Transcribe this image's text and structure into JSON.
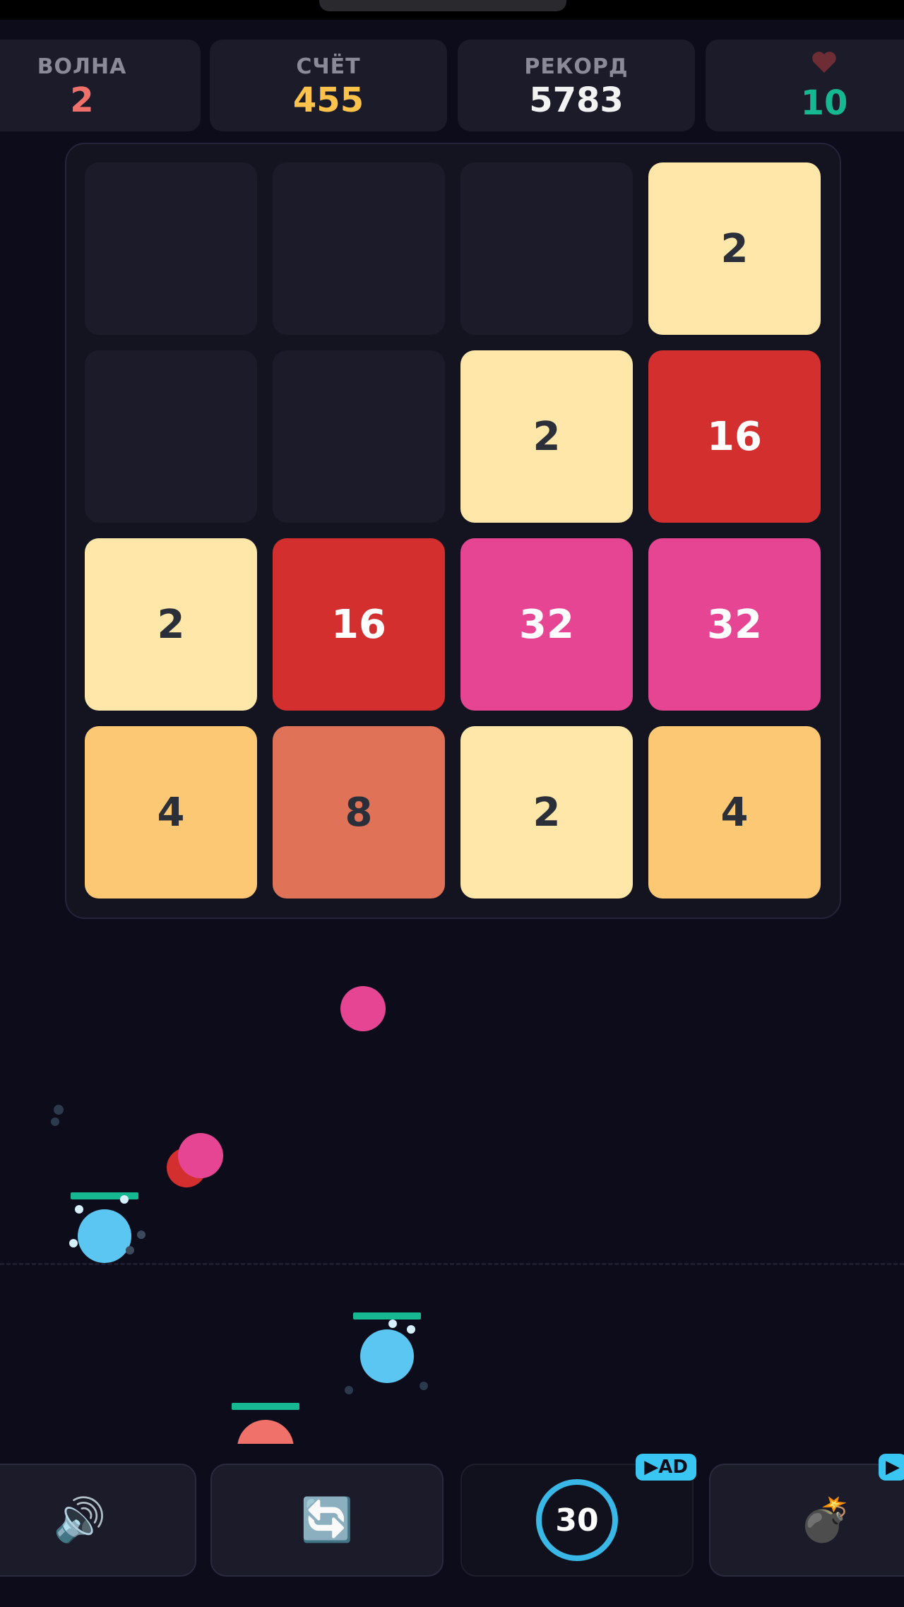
{
  "stats": {
    "wave": {
      "label": "ВОЛНА",
      "value": "2",
      "color": "#f0706a"
    },
    "score": {
      "label": "СЧЁТ",
      "value": "455",
      "color": "#ffc24a"
    },
    "record": {
      "label": "РЕКОРД",
      "value": "5783",
      "color": "#f2f2f2"
    },
    "lives": {
      "label_icon": "heart-icon",
      "value": "10",
      "color": "#16b892"
    }
  },
  "board": {
    "rows": [
      [
        "",
        "",
        "",
        "2"
      ],
      [
        "",
        "",
        "2",
        "16"
      ],
      [
        "2",
        "16",
        "32",
        "32"
      ],
      [
        "4",
        "8",
        "2",
        "4"
      ]
    ],
    "tile_colors": {
      "2": "#fee7a8",
      "4": "#fdc873",
      "8": "#e07258",
      "16": "#d32f2f",
      "32": "#e64593"
    }
  },
  "controls": {
    "sound": {
      "icon": "speaker-icon",
      "glyph": "🔊"
    },
    "restart": {
      "icon": "refresh-icon",
      "glyph": "🔄"
    },
    "timer": {
      "value": "30",
      "badge": "▶AD"
    },
    "bomb": {
      "icon": "bomb-icon",
      "glyph": "💣",
      "badge": "▶"
    }
  }
}
